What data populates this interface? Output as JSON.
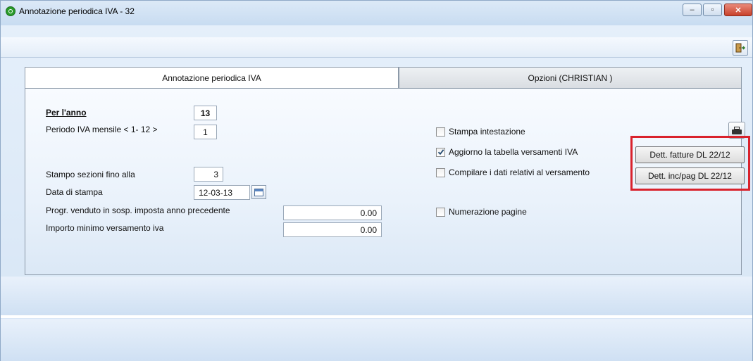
{
  "window": {
    "title": "Annotazione periodica IVA - 32",
    "controls": {
      "minimize": "–",
      "maximize": "▫",
      "close": "✕"
    }
  },
  "toolbar": {
    "exit_icon": "exit-door-icon"
  },
  "tabs": [
    {
      "label": "Annotazione periodica IVA",
      "active": true
    },
    {
      "label": "Opzioni (CHRISTIAN )",
      "active": false
    }
  ],
  "form": {
    "year_label": "Per l'anno",
    "year_value": "13",
    "period_label": "Periodo IVA mensile < 1- 12 >",
    "period_value": "1",
    "sections_label": "Stampo sezioni fino alla",
    "sections_value": "3",
    "print_date_label": "Data di stampa",
    "print_date_value": "12-03-13",
    "sold_label": "Progr. venduto in sosp. imposta anno precedente",
    "sold_value": "0.00",
    "min_payment_label": "Importo minimo versamento iva",
    "min_payment_value": "0.00"
  },
  "options": {
    "print_header": {
      "label": "Stampa intestazione",
      "checked": false
    },
    "update_table": {
      "label": "Aggiorno la tabella versamenti IVA",
      "checked": true
    },
    "fill_payment": {
      "label": "Compilare i dati relativi al versamento",
      "checked": false
    },
    "page_numbering": {
      "label": "Numerazione pagine",
      "checked": false
    }
  },
  "buttons": {
    "dett_fatture": "Dett. fatture DL 22/12",
    "dett_incpag": "Dett. inc/pag DL 22/12"
  },
  "colors": {
    "highlight": "#d9222c",
    "checkmark": "#20486f"
  }
}
